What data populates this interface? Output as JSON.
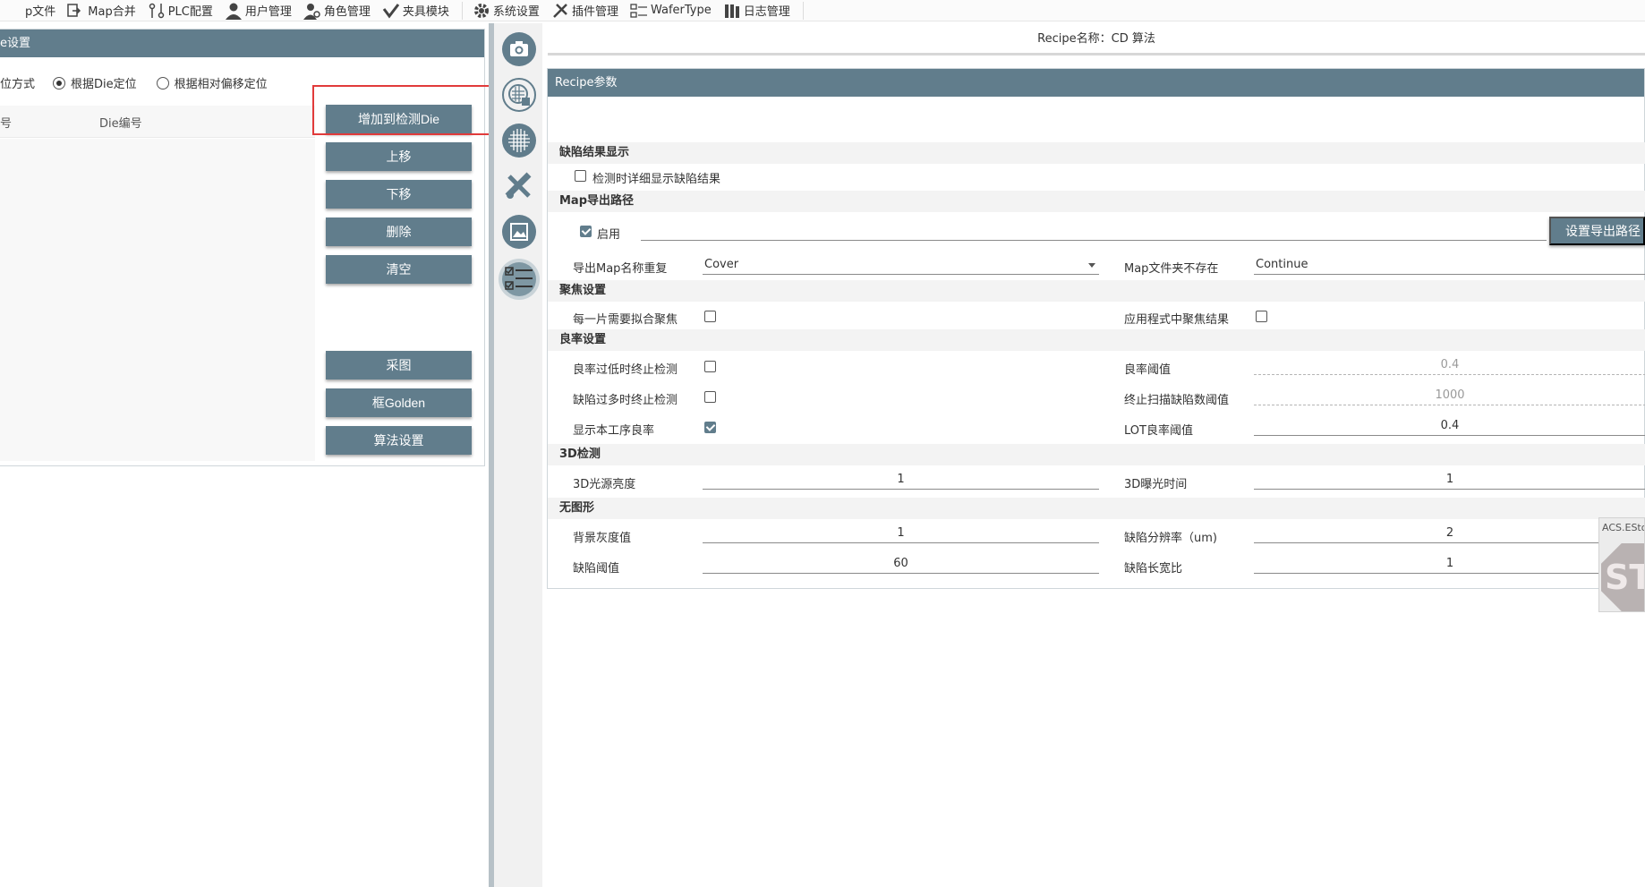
{
  "toolbar": {
    "items": [
      {
        "label": "p文件",
        "icon": "open-file-icon"
      },
      {
        "label": "Map合并",
        "icon": "map-merge-icon"
      },
      {
        "label": "PLC配置",
        "icon": "plc-icon"
      },
      {
        "label": "用户管理",
        "icon": "user-icon"
      },
      {
        "label": "角色管理",
        "icon": "role-icon"
      },
      {
        "label": "夹具模块",
        "icon": "fixture-icon"
      },
      {
        "label": "系统设置",
        "icon": "gear-icon"
      },
      {
        "label": "插件管理",
        "icon": "plugin-icon"
      },
      {
        "label": "WaferType",
        "icon": "wafer-type-icon"
      },
      {
        "label": "日志管理",
        "icon": "log-icon"
      }
    ]
  },
  "left_panel": {
    "header": "e设置",
    "position_mode_label": "位方式",
    "radio_die": "根据Die定位",
    "radio_offset": "根据相对偏移定位",
    "col_index": "号",
    "col_die": "Die编号",
    "buttons": {
      "add": "增加到检测Die",
      "up": "上移",
      "down": "下移",
      "delete": "删除",
      "clear": "清空",
      "capture": "采图",
      "golden": "框Golden",
      "algo": "算法设置"
    }
  },
  "side_icons": [
    "camera-icon",
    "wafer-scan-icon",
    "grid-icon",
    "tools-icon",
    "image-icon",
    "checklist-icon"
  ],
  "recipe_title": "Recipe名称：CD 算法",
  "recipe": {
    "header": "Recipe参数",
    "sec_defect": "缺陷结果显示",
    "detail_show": "检测时详细显示缺陷结果",
    "sec_map": "Map导出路径",
    "enable": "启用",
    "path_value": "",
    "set_path": "设置导出路径",
    "map_dup_label": "导出Map名称重复",
    "map_dup_value": "Cover",
    "map_folder_label": "Map文件夹不存在",
    "map_folder_value": "Continue",
    "sec_focus": "聚焦设置",
    "focus_each": "每一片需要拟合聚焦",
    "focus_apply": "应用程式中聚焦结果",
    "sec_yield": "良率设置",
    "yield_low_stop": "良率过低时终止检测",
    "yield_threshold_label": "良率阈值",
    "yield_threshold_value": "0.4",
    "defect_many_stop": "缺陷过多时终止检测",
    "stop_scan_label": "终止扫描缺陷数阈值",
    "stop_scan_value": "1000",
    "show_yield": "显示本工序良率",
    "lot_yield_label": "LOT良率阈值",
    "lot_yield_value": "0.4",
    "sec_3d": "3D检测",
    "light_label": "3D光源亮度",
    "light_value": "1",
    "exposure_label": "3D曝光时间",
    "exposure_value": "1",
    "sec_nopattern": "无图形",
    "bg_gray_label": "背景灰度值",
    "bg_gray_value": "1",
    "defect_res_label": "缺陷分辨率（um)",
    "defect_res_value": "2",
    "defect_thr_label": "缺陷阈值",
    "defect_thr_value": "60",
    "aspect_label": "缺陷长宽比",
    "aspect_value": "1"
  },
  "stop_widget": {
    "caption": "ACS.ESto",
    "text": "STO"
  },
  "colors": {
    "accent": "#617d8c",
    "highlight": "#e13b3b"
  }
}
